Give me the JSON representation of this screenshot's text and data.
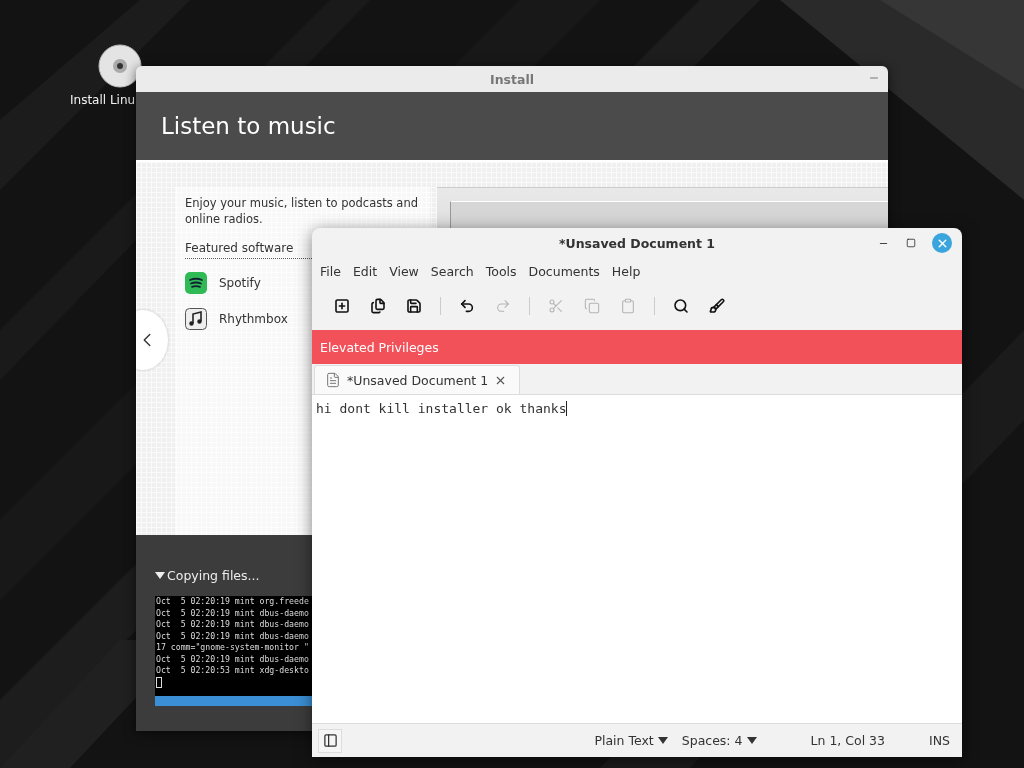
{
  "desktop": {
    "icons": [
      {
        "label": "Install Linu"
      }
    ]
  },
  "install_window": {
    "title": "Install",
    "header": "Listen to music",
    "description": "Enjoy your music, listen to podcasts and online radios.",
    "featured_title": "Featured software",
    "featured": [
      {
        "kind": "spotify",
        "name": "Spotify"
      },
      {
        "kind": "rhythmbox",
        "name": "Rhythmbox"
      }
    ],
    "progress_label": "Copying files...",
    "log_lines": [
      "Oct  5 02:20:19 mint org.freede",
      "Oct  5 02:20:19 mint dbus-daemo",
      "Oct  5 02:20:19 mint dbus-daemo",
      "Oct  5 02:20:19 mint dbus-daemo",
      "17 comm=\"gnome-system-monitor \"",
      "Oct  5 02:20:19 mint dbus-daemo",
      "Oct  5 02:20:53 mint xdg-deskto"
    ],
    "progress": {
      "level": 1
    }
  },
  "editor_window": {
    "title": "*Unsaved Document 1",
    "menu": [
      "File",
      "Edit",
      "View",
      "Search",
      "Tools",
      "Documents",
      "Help"
    ],
    "toolbar": [
      {
        "kind": "new",
        "disabled": false
      },
      {
        "kind": "open",
        "disabled": false
      },
      {
        "kind": "save",
        "disabled": false
      },
      {
        "kind": "separator"
      },
      {
        "kind": "undo",
        "disabled": false
      },
      {
        "kind": "redo",
        "disabled": true
      },
      {
        "kind": "separator"
      },
      {
        "kind": "cut",
        "disabled": true
      },
      {
        "kind": "copy",
        "disabled": true
      },
      {
        "kind": "paste",
        "disabled": true
      },
      {
        "kind": "separator"
      },
      {
        "kind": "find",
        "disabled": false
      },
      {
        "kind": "replace",
        "disabled": false
      }
    ],
    "banner": "Elevated Privileges",
    "tabs": [
      {
        "label": "*Unsaved Document 1",
        "selected": true
      }
    ],
    "content": "hi dont kill installer ok thanks",
    "status_bar": {
      "language": "Plain Text",
      "spaces": "Spaces: 4",
      "position": "Ln 1, Col 33",
      "mode": "INS"
    }
  }
}
